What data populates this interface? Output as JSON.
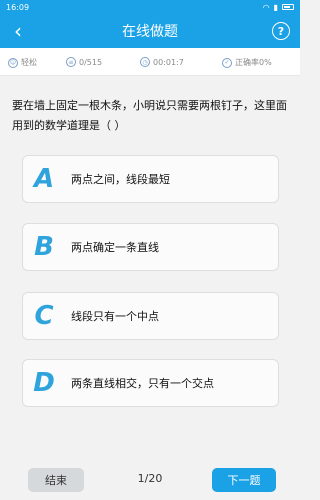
{
  "statusbar": {
    "time": "16:09"
  },
  "header": {
    "title": "在线做题"
  },
  "info": {
    "difficulty": "轻松",
    "progress": "0/515",
    "timer": "00:01:7",
    "accuracy": "正确率0%"
  },
  "question": {
    "text": "要在墙上固定一根木条，小明说只需要两根钉子，这里面用到的数学道理是（    ）"
  },
  "options": [
    {
      "letter": "A",
      "text": "两点之间，线段最短"
    },
    {
      "letter": "B",
      "text": "两点确定一条直线"
    },
    {
      "letter": "C",
      "text": "线段只有一个中点"
    },
    {
      "letter": "D",
      "text": "两条直线相交，只有一个交点"
    }
  ],
  "footer": {
    "end_label": "结束",
    "page": "1/20",
    "next_label": "下一题"
  },
  "colors": {
    "primary": "#1aa1e6",
    "option_letter": "#2ea3dc"
  }
}
